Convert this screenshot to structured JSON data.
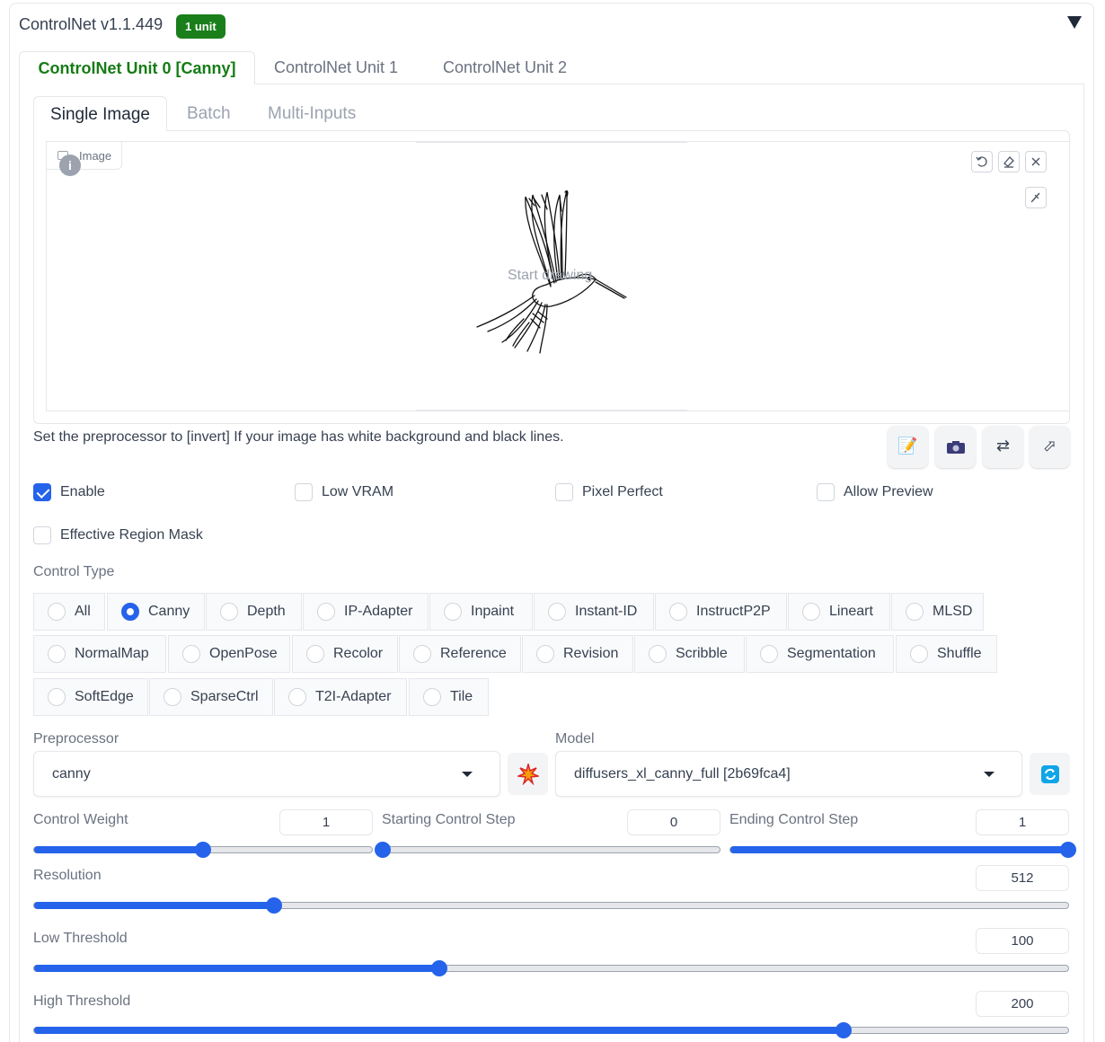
{
  "header": {
    "title": "ControlNet v1.1.449",
    "badge": "1 unit",
    "collapse_icon": "triangle-down-icon"
  },
  "unit_tabs": [
    {
      "label": "ControlNet Unit 0 [Canny]",
      "active": true
    },
    {
      "label": "ControlNet Unit 1",
      "active": false
    },
    {
      "label": "ControlNet Unit 2",
      "active": false
    }
  ],
  "input_tabs": [
    {
      "label": "Single Image",
      "active": true
    },
    {
      "label": "Batch",
      "active": false
    },
    {
      "label": "Multi-Inputs",
      "active": false
    }
  ],
  "image_panel": {
    "label": "Image",
    "info_glyph": "i",
    "canvas_hint": "Start drawing",
    "tools": [
      "undo-icon",
      "eraser-icon",
      "close-icon",
      "brush-icon"
    ]
  },
  "note": "Set the preprocessor to [invert] If your image has white background and black lines.",
  "action_buttons": [
    "edit-icon",
    "camera-icon",
    "swap-icon",
    "send-dimensions-icon"
  ],
  "options": {
    "enable": {
      "label": "Enable",
      "checked": true
    },
    "low_vram": {
      "label": "Low VRAM",
      "checked": false
    },
    "pixel_perfect": {
      "label": "Pixel Perfect",
      "checked": false
    },
    "allow_preview": {
      "label": "Allow Preview",
      "checked": false
    },
    "effective_region_mask": {
      "label": "Effective Region Mask",
      "checked": false
    }
  },
  "control_type": {
    "label": "Control Type",
    "selected": "Canny",
    "options": [
      "All",
      "Canny",
      "Depth",
      "IP-Adapter",
      "Inpaint",
      "Instant-ID",
      "InstructP2P",
      "Lineart",
      "MLSD",
      "NormalMap",
      "OpenPose",
      "Recolor",
      "Reference",
      "Revision",
      "Scribble",
      "Segmentation",
      "Shuffle",
      "SoftEdge",
      "SparseCtrl",
      "T2I-Adapter",
      "Tile"
    ]
  },
  "preprocessor": {
    "label": "Preprocessor",
    "value": "canny",
    "run_icon": "explosion-icon"
  },
  "model": {
    "label": "Model",
    "value": "diffusers_xl_canny_full [2b69fca4]",
    "refresh_icon": "refresh-icon"
  },
  "sliders": {
    "control_weight": {
      "label": "Control Weight",
      "value": "1",
      "fraction": 0.5
    },
    "starting_step": {
      "label": "Starting Control Step",
      "value": "0",
      "fraction": 0.0
    },
    "ending_step": {
      "label": "Ending Control Step",
      "value": "1",
      "fraction": 1.0
    },
    "resolution": {
      "label": "Resolution",
      "value": "512",
      "fraction": 0.232
    },
    "low_threshold": {
      "label": "Low Threshold",
      "value": "100",
      "fraction": 0.392
    },
    "high_threshold": {
      "label": "High Threshold",
      "value": "200",
      "fraction": 0.783
    }
  },
  "colors": {
    "accent": "#2563eb",
    "badge": "#1a7f1a",
    "active_tab": "#167c16"
  }
}
